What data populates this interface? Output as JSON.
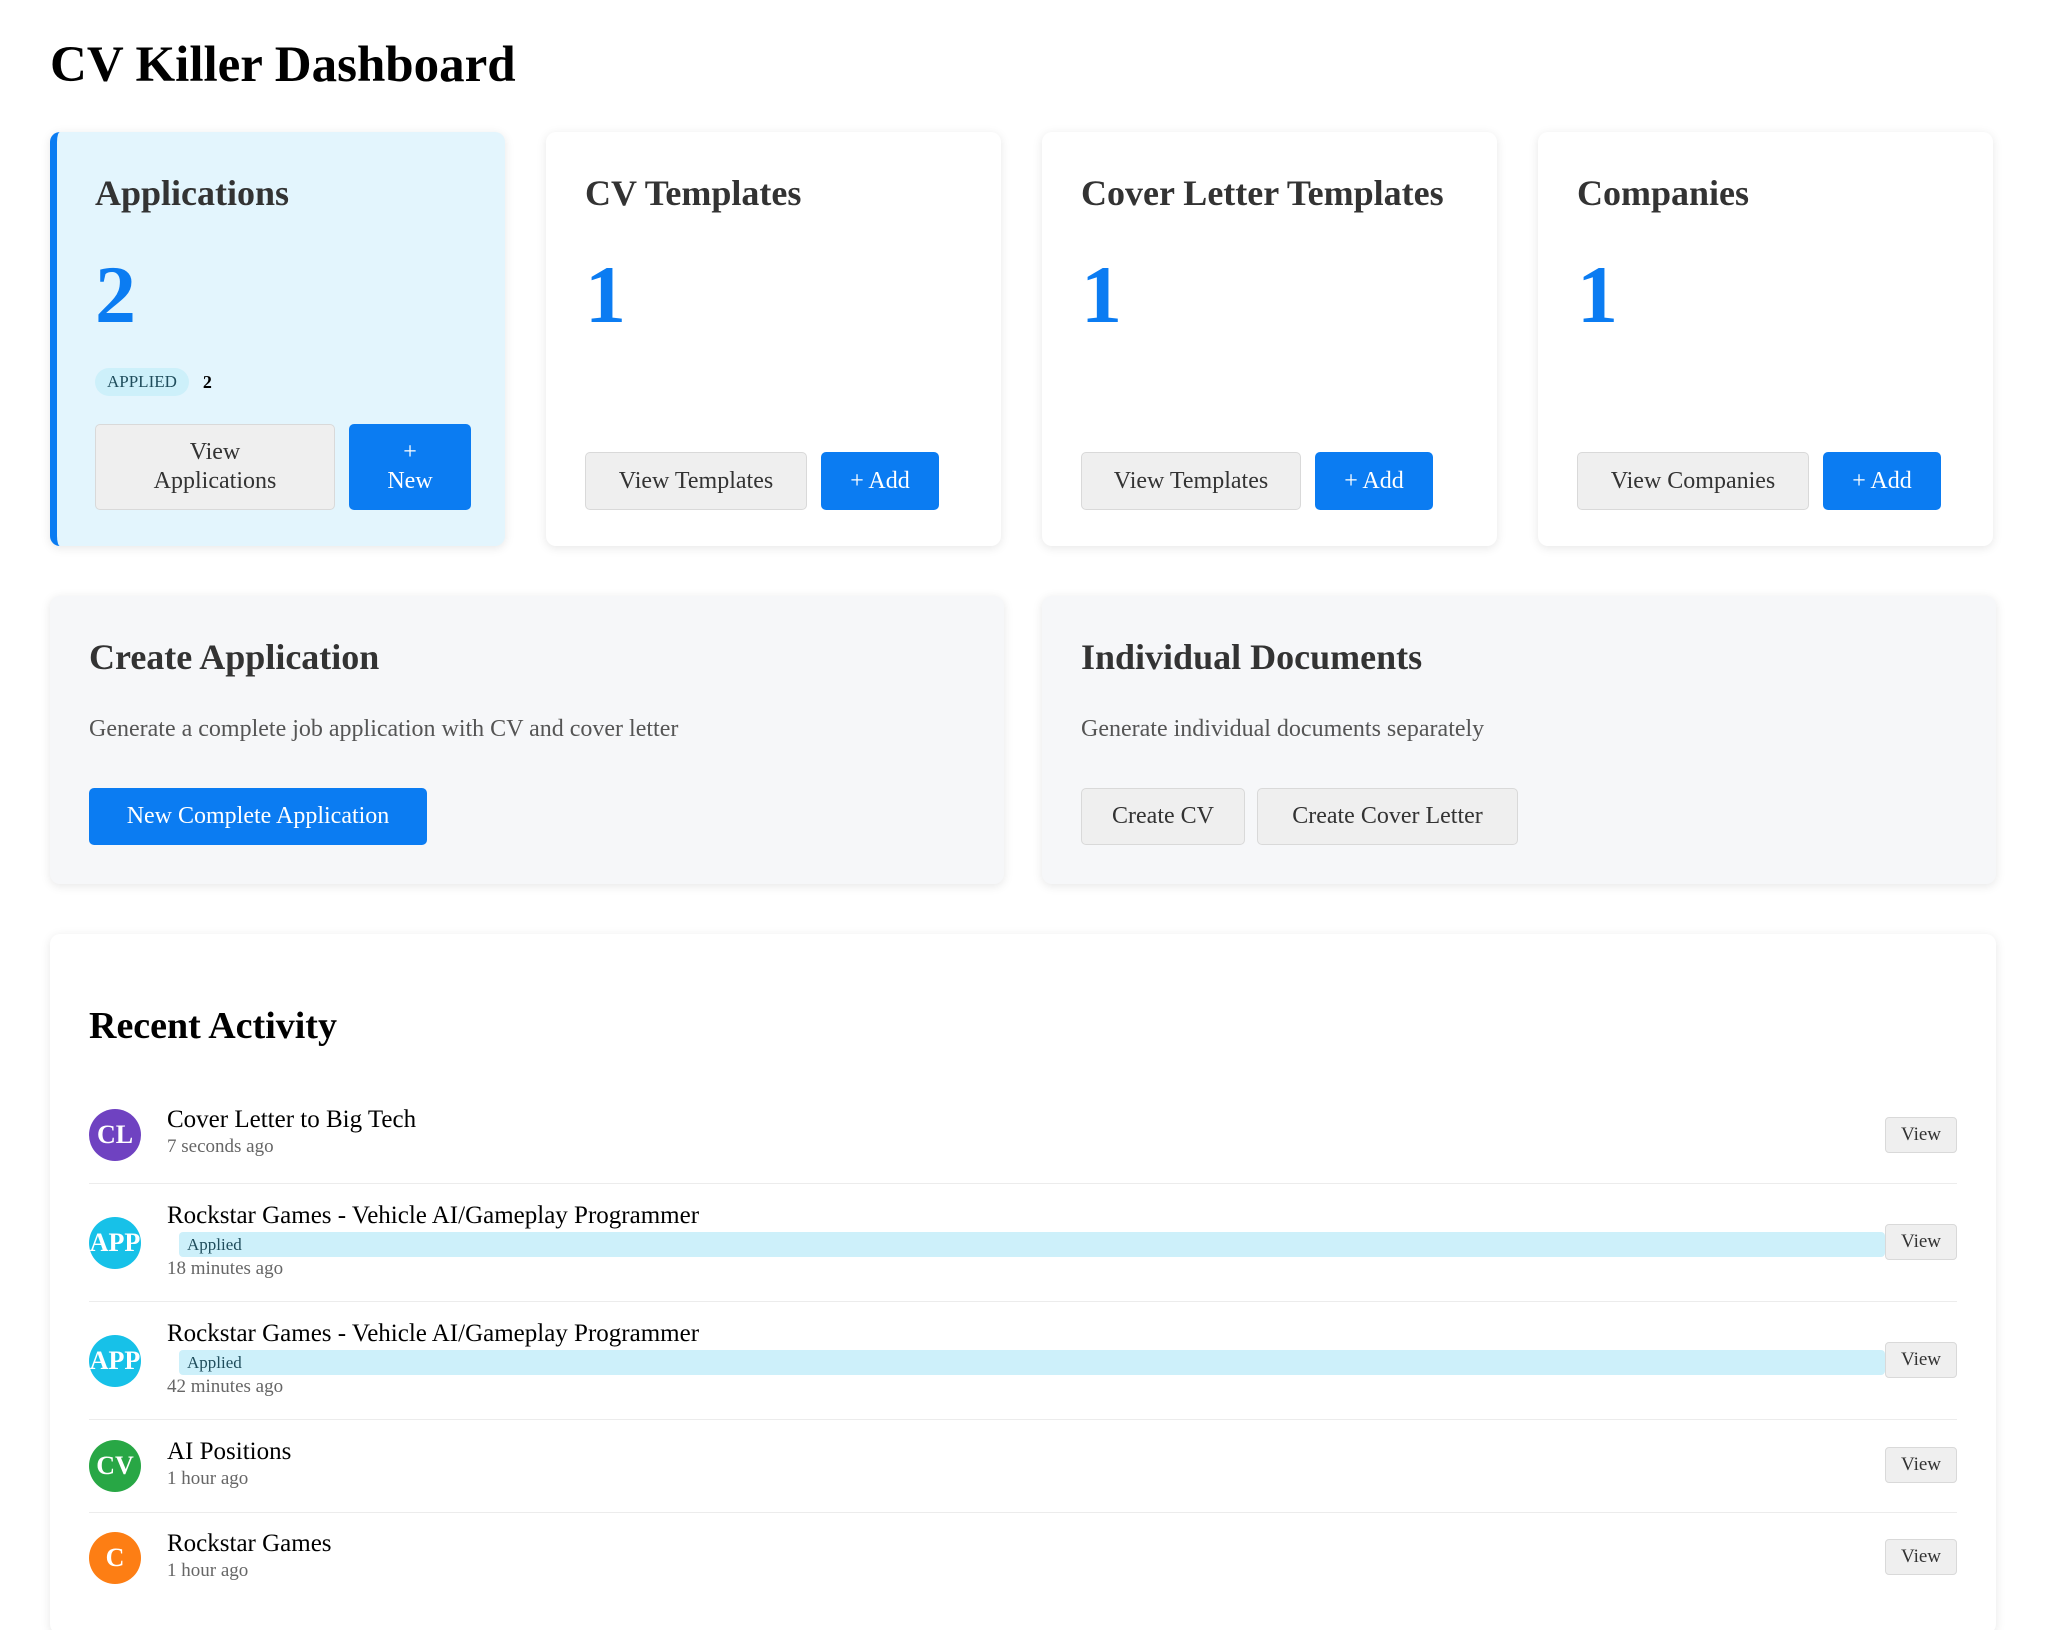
{
  "page": {
    "title": "CV Killer Dashboard"
  },
  "stats": [
    {
      "title": "Applications",
      "count": "2",
      "status_label": "APPLIED",
      "status_count": "2",
      "view_label": "View Applications",
      "add_label": "+ New"
    },
    {
      "title": "CV Templates",
      "count": "1",
      "view_label": "View Templates",
      "add_label": "+ Add"
    },
    {
      "title": "Cover Letter Templates",
      "count": "1",
      "view_label": "View Templates",
      "add_label": "+ Add"
    },
    {
      "title": "Companies",
      "count": "1",
      "view_label": "View Companies",
      "add_label": "+ Add"
    }
  ],
  "create_application": {
    "title": "Create Application",
    "description": "Generate a complete job application with CV and cover letter",
    "button_label": "New Complete Application"
  },
  "individual_documents": {
    "title": "Individual Documents",
    "description": "Generate individual documents separately",
    "create_cv_label": "Create CV",
    "create_cover_letter_label": "Create Cover Letter"
  },
  "recent_activity": {
    "title": "Recent Activity",
    "view_label": "View",
    "items": [
      {
        "avatar": "CL",
        "avatar_color": "#6f42c1",
        "title": "Cover Letter to Big Tech",
        "time": "7 seconds ago"
      },
      {
        "avatar": "APP",
        "avatar_color": "#17c1e8",
        "title": "Rockstar Games - Vehicle AI/Gameplay Programmer",
        "badge": "Applied",
        "time": "18 minutes ago"
      },
      {
        "avatar": "APP",
        "avatar_color": "#17c1e8",
        "title": "Rockstar Games - Vehicle AI/Gameplay Programmer",
        "badge": "Applied",
        "time": "42 minutes ago"
      },
      {
        "avatar": "CV",
        "avatar_color": "#28a745",
        "title": "AI Positions",
        "time": "1 hour ago"
      },
      {
        "avatar": "C",
        "avatar_color": "#fd7e14",
        "title": "Rockstar Games",
        "time": "1 hour ago"
      }
    ]
  },
  "colors": {
    "accent": "#0b7cf2",
    "active_card_bg": "#e3f5fd",
    "badge_bg": "#cdf0fa"
  }
}
